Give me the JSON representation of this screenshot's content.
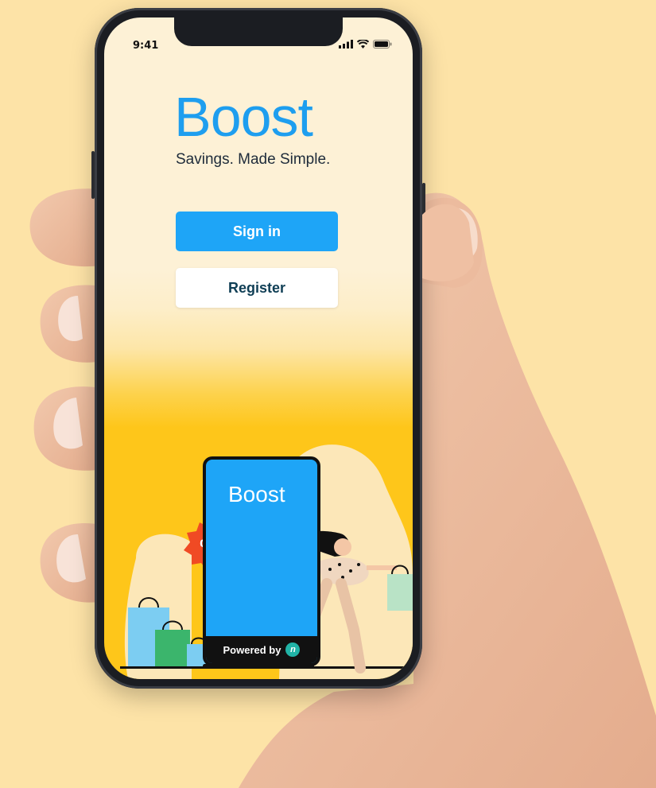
{
  "status_bar": {
    "time": "9:41",
    "icons": [
      "signal-icon",
      "wifi-icon",
      "battery-icon"
    ]
  },
  "app": {
    "name": "Boost",
    "tagline": "Savings. Made Simple."
  },
  "buttons": {
    "sign_in": "Sign in",
    "register": "Register"
  },
  "illustration": {
    "phone_logo": "Boost",
    "discount_badge": "%",
    "powered_by": "Powered by",
    "powered_logo": "n"
  },
  "colors": {
    "background": "#fde3a7",
    "brand_blue": "#1e9eef",
    "button_blue": "#1ea5f7",
    "yellow": "#fec61a",
    "register_text": "#0f3e55",
    "badge_red": "#f04a24"
  }
}
